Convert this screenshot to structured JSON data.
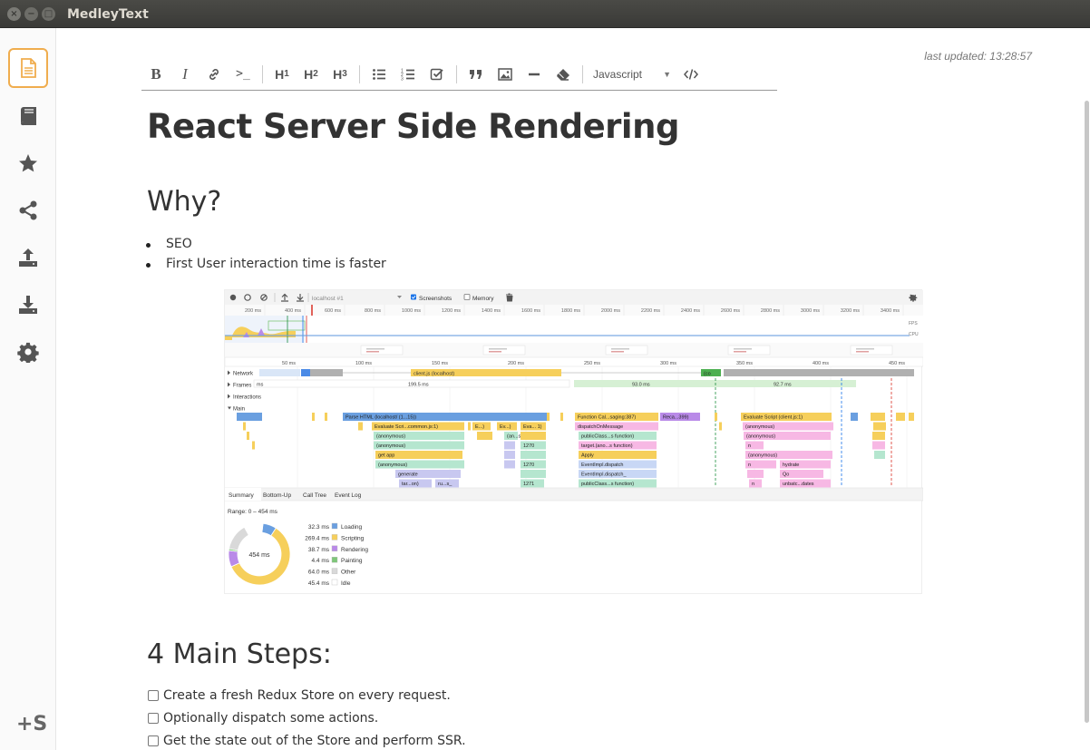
{
  "window": {
    "title": "MedleyText",
    "close_glyph": "×",
    "min_glyph": "−",
    "max_glyph": "□"
  },
  "sidebar": {
    "items": [
      {
        "name": "note-icon",
        "active": true
      },
      {
        "name": "notebook-icon",
        "active": false
      },
      {
        "name": "star-icon",
        "active": false
      },
      {
        "name": "share-icon",
        "active": false
      },
      {
        "name": "upload-icon",
        "active": false
      },
      {
        "name": "download-icon",
        "active": false
      },
      {
        "name": "gear-icon",
        "active": false
      }
    ],
    "logo": "+S"
  },
  "header": {
    "last_updated": "last updated: 13:28:57"
  },
  "toolbar": {
    "bold": "B",
    "italic": "I",
    "code": ">_",
    "h1": "H",
    "h1_sub": "1",
    "h2": "H",
    "h2_sub": "2",
    "h3": "H",
    "h3_sub": "3",
    "language": "Javascript",
    "accent": "#f0ad4e"
  },
  "document": {
    "title": "React Server Side Rendering",
    "h_why": "Why?",
    "bullets": [
      "SEO",
      "First User interaction time is faster"
    ],
    "h_steps": "4 Main Steps:",
    "tasks": [
      "Create a fresh Redux Store on every request.",
      "Optionally dispatch some actions.",
      "Get the state out of the Store and perform SSR."
    ]
  },
  "perf_image": {
    "tab_url": "localhost #1",
    "screenshots": "Screenshots",
    "memory": "Memory",
    "overview_ticks": [
      "200 ms",
      "400 ms",
      "600 ms",
      "800 ms",
      "1000 ms",
      "1200 ms",
      "1400 ms",
      "1600 ms",
      "1800 ms",
      "2000 ms",
      "2200 ms",
      "2400 ms",
      "2600 ms",
      "2800 ms",
      "3000 ms",
      "3200 ms",
      "3400 ms"
    ],
    "side_labels": [
      "FPS",
      "CPU",
      "NET"
    ],
    "detail_ticks": [
      "50 ms",
      "100 ms",
      "150 ms",
      "200 ms",
      "250 ms",
      "300 ms",
      "350 ms",
      "400 ms",
      "450 ms"
    ],
    "tracks": [
      "Network",
      "Frames",
      "Interactions",
      "Main"
    ],
    "network_bar": "client.js (localhost)",
    "network_bar2": "(co",
    "frame_ms": [
      "199.5 ms",
      "93.0 ms",
      "92.7 ms"
    ],
    "frame_prefix": "ms",
    "flame": {
      "parse": "Parse HTML (localhost/ (1...15))",
      "func": "Function Cal...saging:387)",
      "reca": "Reca...399)",
      "evalscript": "Evaluate Script (client.js:1)",
      "evalscr2": "Evaluate Scri...common.js:1)",
      "e1": "E...)",
      "ev1": "Ev...)",
      "eva1": "Eva... 1)",
      "dispatch": "dispatchOnMessage",
      "anon1": "(anonymous)",
      "anon2": "(anonymous)",
      "anon3": "(anonymous)",
      "anon4": "(anonymous)",
      "anon5": "(anonymous)",
      "ans": "(an...s)",
      "pub1": "publicClass...s function)",
      "target": "target.(ano...s function)",
      "getapp": "get app",
      "apply": "Apply",
      "evt1": "EventImpl.dispatch",
      "evt2": "EventImpl.dispatch_",
      "pub2": "publicClass...s function)",
      "generate": "generate",
      "taron": "tar...on)",
      "rus": "ru...s_",
      "n1270a": "1270",
      "n1270b": "1270",
      "n1271": "1271",
      "n": "n",
      "hydrate": "hydrate",
      "qo": "Qo",
      "unbatc": "unbatc...dates"
    },
    "bottom_tabs": [
      "Summary",
      "Bottom-Up",
      "Call Tree",
      "Event Log"
    ],
    "range": "Range: 0 – 454 ms",
    "donut_center": "454 ms",
    "summary": [
      {
        "ms": "32.3 ms",
        "label": "Loading",
        "color": "#6a9fe0",
        "value": 32.3
      },
      {
        "ms": "269.4 ms",
        "label": "Scripting",
        "color": "#f6cf5b",
        "value": 269.4
      },
      {
        "ms": "38.7 ms",
        "label": "Rendering",
        "color": "#b98ae8",
        "value": 38.7
      },
      {
        "ms": "4.4 ms",
        "label": "Painting",
        "color": "#7fc67a",
        "value": 4.4
      },
      {
        "ms": "64.0 ms",
        "label": "Other",
        "color": "#d9d9d9",
        "value": 64.0
      },
      {
        "ms": "45.4 ms",
        "label": "Idle",
        "color": "#ffffff",
        "value": 45.4
      }
    ]
  }
}
